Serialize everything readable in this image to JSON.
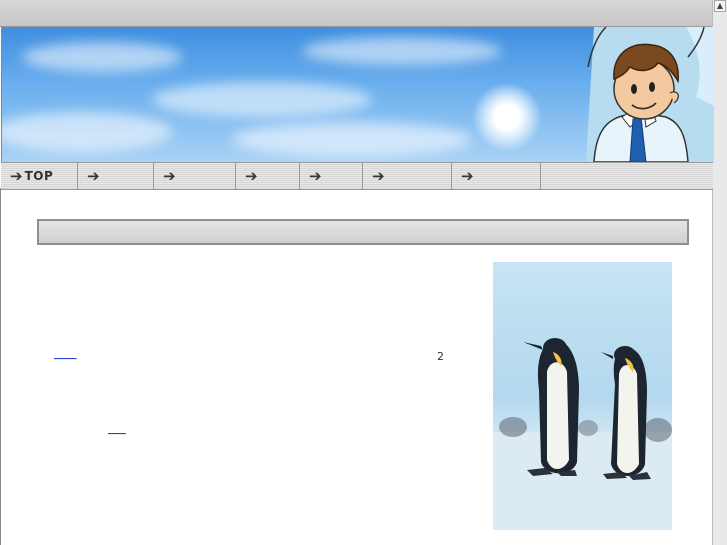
{
  "nav": {
    "items": [
      {
        "label": "TOP"
      },
      {
        "label": ""
      },
      {
        "label": ""
      },
      {
        "label": ""
      },
      {
        "label": ""
      },
      {
        "label": ""
      },
      {
        "label": ""
      }
    ]
  },
  "content": {
    "number_text": "2",
    "link1_text": "_____",
    "link2_text": "____"
  },
  "icons": {
    "nav_arrow": "arrow-right-icon",
    "scroll_up": "arrow-up-icon"
  },
  "colors": {
    "sky": "#5aa3e8",
    "link": "#2244cc",
    "nav_bg": "#e0e0e0"
  }
}
